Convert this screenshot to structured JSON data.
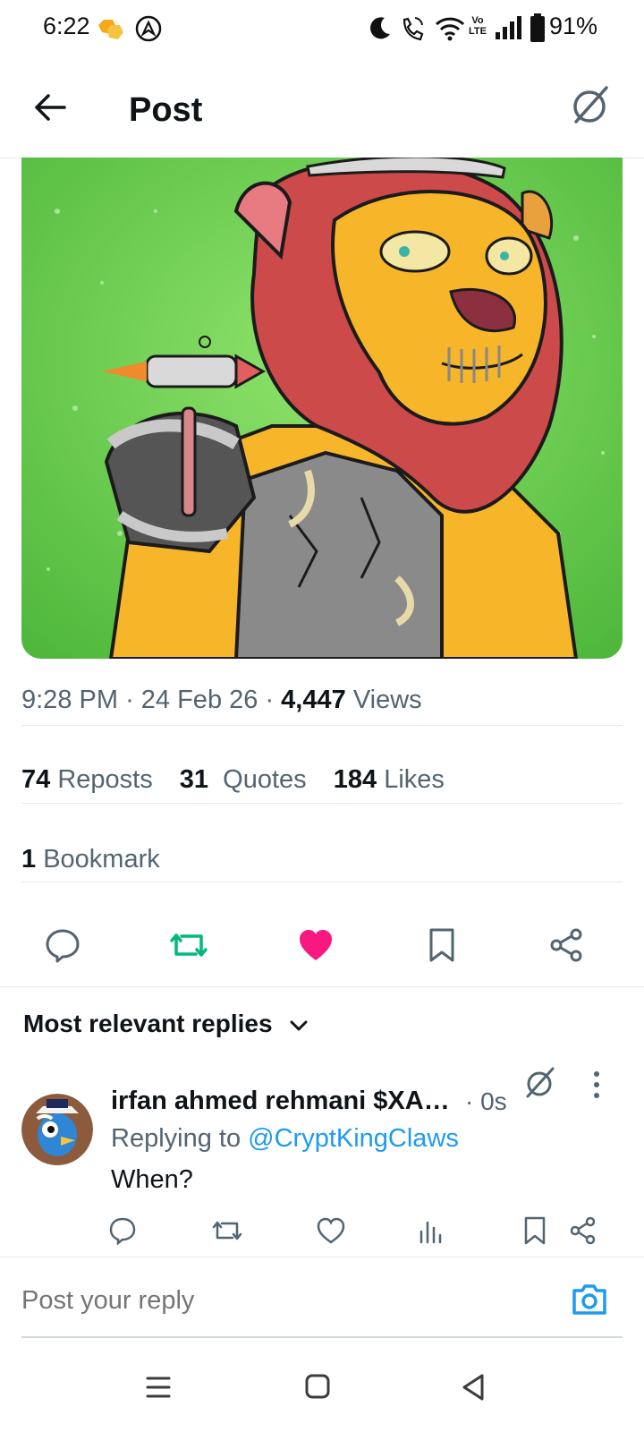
{
  "status_bar": {
    "time": "6:22",
    "battery_percent": "91%",
    "network": "Vo LTE"
  },
  "header": {
    "title": "Post"
  },
  "post": {
    "time": "9:28 PM",
    "date": "24 Feb 26",
    "views_count": "4,447",
    "views_label": "Views",
    "reposts_count": "74",
    "reposts_label": "Reposts",
    "quotes_count": "31",
    "quotes_label": "Quotes",
    "likes_count": "184",
    "likes_label": "Likes",
    "bookmarks_count": "1",
    "bookmarks_label": "Bookmark",
    "liked": true,
    "reposted": true
  },
  "replies": {
    "sort_label": "Most relevant replies",
    "items": [
      {
        "author": "irfan ahmed rehmani $XA…",
        "time": "· 0s",
        "replying_prefix": "Replying to",
        "replying_handle": "@CryptKingClaws",
        "text": "When?"
      }
    ]
  },
  "composer": {
    "placeholder": "Post your reply"
  },
  "colors": {
    "accent": "#1d9bf0",
    "like": "#f91880",
    "repost": "#00ba7c",
    "secondary_text": "#536471"
  }
}
